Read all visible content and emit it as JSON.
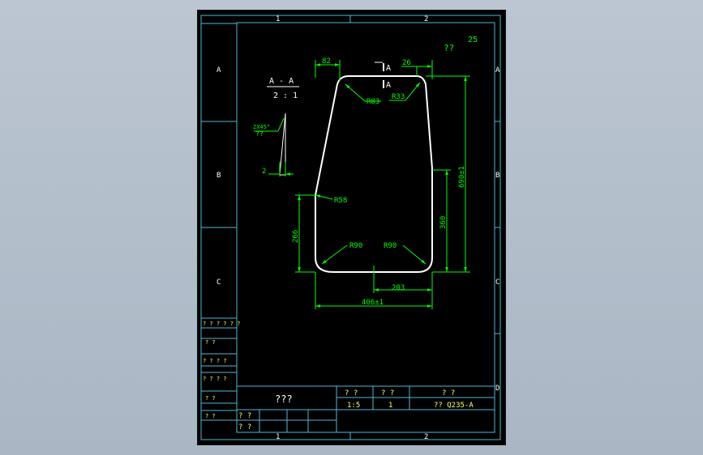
{
  "colors": {
    "background": "#b3bfcc",
    "sheet": "#000000",
    "frame": "#4fb8d8",
    "profile": "#ffffff",
    "dimension": "#00ff00",
    "title_text": "#ffff66",
    "grid_label": "#ffffff"
  },
  "border": {
    "top_zone_1": "1",
    "top_zone_2": "2",
    "bottom_zone_1": "1",
    "bottom_zone_2": "2",
    "left_A": "A",
    "left_B": "B",
    "left_C": "C",
    "right_A": "A",
    "right_B": "B",
    "right_C": "C",
    "right_D": "D"
  },
  "header": {
    "roughness_value": "25",
    "roughness_symbol": "??"
  },
  "section_view": {
    "title": "A - A",
    "scale": "2 : 1",
    "chamfer": "2X45°",
    "chamfer_note": "??",
    "width_dim": "2"
  },
  "section_marks": {
    "mark_top": "A",
    "mark_bottom": "A"
  },
  "dimensions": {
    "top_left_width": "82",
    "top_right_width": "26",
    "radius_top_left": "R83",
    "radius_top_right": "R33",
    "radius_side": "R58",
    "radius_bottom_left": "R90",
    "radius_bottom_right": "R90",
    "overall_height": "690±1",
    "right_height": "360",
    "left_height": "266",
    "bottom_half_width": "203",
    "overall_width": "406±1"
  },
  "revision_block": {
    "rows": [
      "? ? ? ? ? ?",
      "? ?",
      "? ? ? ?",
      "? ? ? ?",
      "? ?",
      "? ?"
    ]
  },
  "title_block": {
    "part_name": "???",
    "col1_header": "? ?",
    "col2_header": "? ?",
    "col3_header": "? ?",
    "scale_value": "1:5",
    "quantity_value": "1",
    "material_value": "?? Q235-A",
    "sign_row1": "? ?",
    "sign_row2": "? ?",
    "sign_row1b": "?",
    "sign_row2b": "?"
  }
}
